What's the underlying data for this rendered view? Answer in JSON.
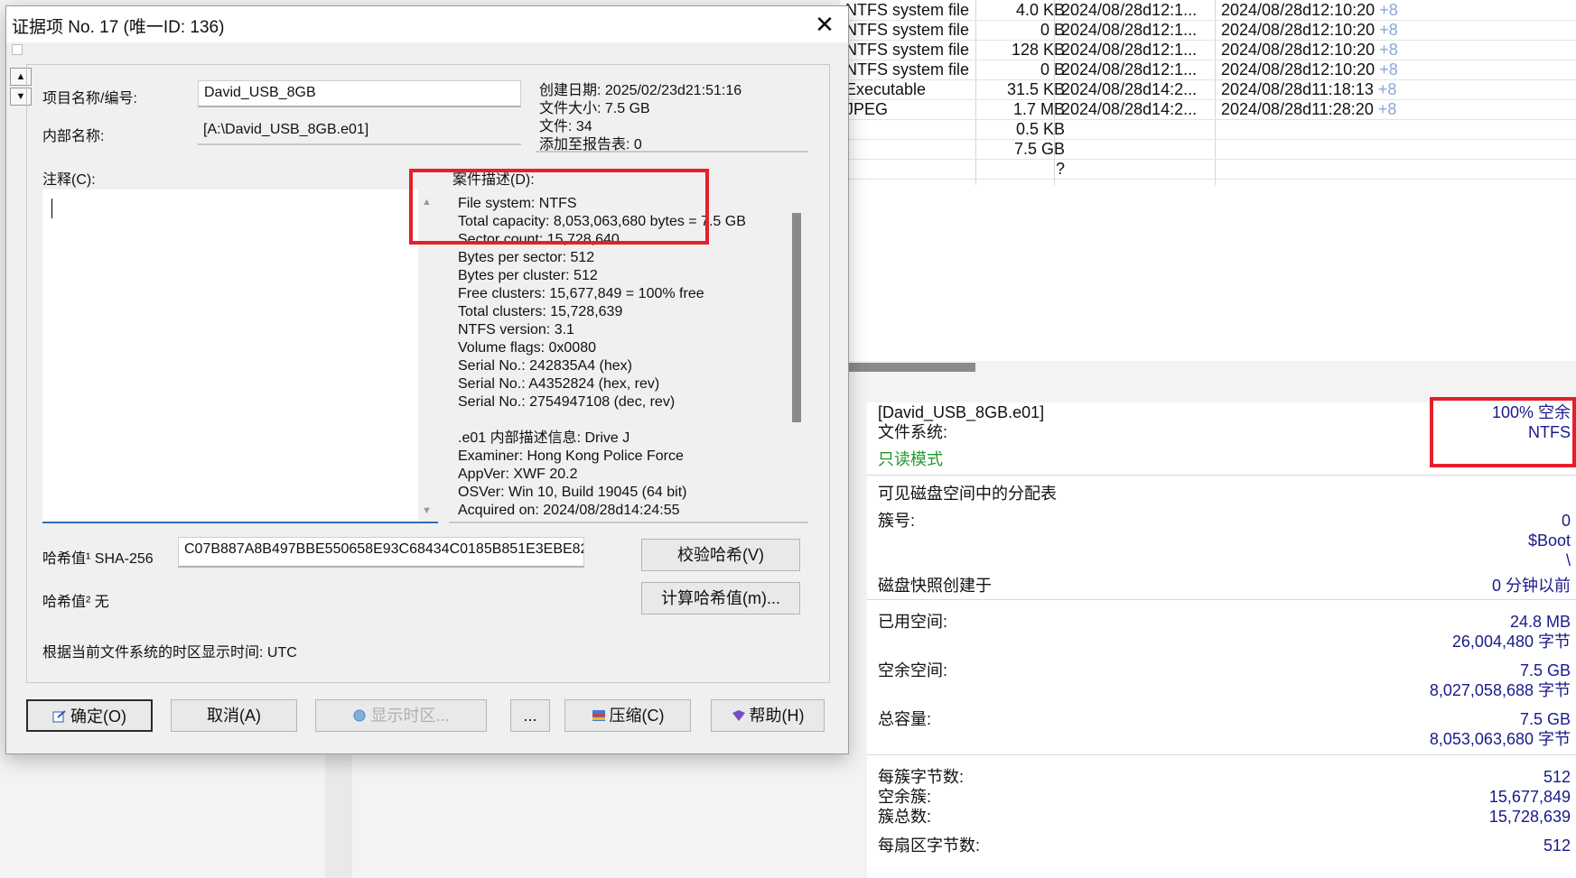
{
  "file_table": {
    "rows": [
      {
        "type": "NTFS system file",
        "size": "4.0 KB",
        "modified": "2024/08/28d12:1...",
        "created": "2024/08/28d12:10:20",
        "extra": "+8"
      },
      {
        "type": "NTFS system file",
        "size": "0 B",
        "modified": "2024/08/28d12:1...",
        "created": "2024/08/28d12:10:20",
        "extra": "+8"
      },
      {
        "type": "NTFS system file",
        "size": "128 KB",
        "modified": "2024/08/28d12:1...",
        "created": "2024/08/28d12:10:20",
        "extra": "+8"
      },
      {
        "type": "NTFS system file",
        "size": "0 B",
        "modified": "2024/08/28d12:1...",
        "created": "2024/08/28d12:10:20",
        "extra": "+8"
      },
      {
        "type": "Executable",
        "size": "31.5 KB",
        "modified": "2024/08/28d14:2...",
        "created": "2024/08/28d11:18:13",
        "extra": "+8"
      },
      {
        "type": "JPEG",
        "size": "1.7 MB",
        "modified": "2024/08/28d14:2...",
        "created": "2024/08/28d11:28:20",
        "extra": "+8"
      },
      {
        "type": "",
        "size": "0.5 KB",
        "modified": "",
        "created": "",
        "extra": ""
      },
      {
        "type": "",
        "size": "7.5 GB",
        "modified": "",
        "created": "",
        "extra": ""
      },
      {
        "type": "",
        "size": "?",
        "modified": "",
        "created": "",
        "extra": ""
      }
    ]
  },
  "info_panel": {
    "image_name": "[David_USB_8GB.e01]",
    "free_pct": "100% 空余",
    "fs_label": "文件系统:",
    "fs_value": "NTFS",
    "readonly": "只读模式",
    "partition_table": "可见磁盘空间中的分配表",
    "cluster_label": "簇号:",
    "cluster_value": "0",
    "boot": "$Boot",
    "root": "\\",
    "snapshot_label": "磁盘快照创建于",
    "snapshot_value": "0 分钟以前",
    "used_label": "已用空间:",
    "used_value": "24.8 MB",
    "used_bytes": "26,004,480 字节",
    "free_label": "空余空间:",
    "free_value": "7.5 GB",
    "free_bytes": "8,027,058,688 字节",
    "total_label": "总容量:",
    "total_value": "7.5 GB",
    "total_bytes": "8,053,063,680 字节",
    "bpc_label": "每簇字节数:",
    "bpc_value": "512",
    "free_clusters_label": "空余簇:",
    "free_clusters_value": "15,677,849",
    "total_clusters_label": "簇总数:",
    "total_clusters_value": "15,728,639",
    "bps_label": "每扇区字节数:",
    "bps_value": "512"
  },
  "dialog": {
    "title": "证据项 No. 17 (唯一ID: 136)",
    "close_glyph": "✕",
    "name_label": "项目名称/编号:",
    "name_value": "David_USB_8GB",
    "internal_label": "内部名称:",
    "internal_value": "[A:\\David_USB_8GB.e01]",
    "info": {
      "created": "创建日期: 2025/02/23d21:51:16",
      "size": "文件大小: 7.5 GB",
      "files": "文件: 34",
      "added": "添加至报告表: 0"
    },
    "comment_label": "注释(C):",
    "desc_label": "案件描述(D):",
    "desc_lines": [
      "File system: NTFS",
      "Total capacity: 8,053,063,680 bytes = 7.5 GB",
      "Sector count: 15,728,640",
      "Bytes per sector: 512",
      "Bytes per cluster: 512",
      "Free clusters: 15,677,849 = 100% free",
      "Total clusters: 15,728,639",
      "NTFS version: 3.1",
      "Volume flags: 0x0080",
      "Serial No.: 242835A4 (hex)",
      "Serial No.: A4352824 (hex, rev)",
      "Serial No.: 2754947108 (dec, rev)",
      "",
      ".e01 内部描述信息: Drive J",
      "Examiner: Hong Kong Police Force",
      "AppVer: XWF 20.2",
      "OSVer: Win 10, Build 19045 (64 bit)",
      "Acquired on: 2024/08/28d14:24:55"
    ],
    "hash1_label": "哈希值¹  SHA-256",
    "hash1_value": "C07B887A8B497BBE550658E93C68434C0185B851E3EBE82",
    "hash2_label": "哈希值²  无",
    "verify_btn": "校验哈希(V)",
    "compute_btn": "计算哈希值(m)...",
    "timezone_text": "根据当前文件系统的时区显示时间: UTC",
    "buttons": {
      "ok": "确定(O)",
      "cancel": "取消(A)",
      "timezone": "显示时区...",
      "more": "...",
      "compress": "压缩(C)",
      "help": "帮助(H)"
    }
  },
  "colors": {
    "highlight_red": "#e3202b",
    "value_blue": "#1a1a8c",
    "readonly_green": "#1f9a2c"
  }
}
